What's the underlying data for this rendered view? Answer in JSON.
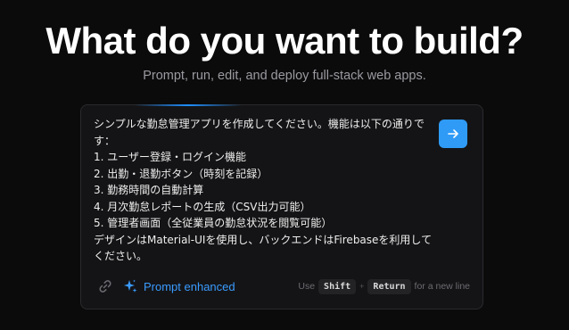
{
  "hero": {
    "title": "What do you want to build?",
    "subtitle": "Prompt, run, edit, and deploy full-stack web apps."
  },
  "prompt": {
    "text": "シンプルな勤怠管理アプリを作成してください。機能は以下の通りです：\n1. ユーザー登録・ログイン機能\n2. 出勤・退勤ボタン（時刻を記録）\n3. 勤務時間の自動計算\n4. 月次勤怠レポートの生成（CSV出力可能）\n5. 管理者画面（全従業員の勤怠状況を閲覧可能）\nデザインはMaterial-UIを使用し、バックエンドはFirebaseを利用してください。"
  },
  "submit": {
    "icon": "arrow-right-icon"
  },
  "footer": {
    "link_icon": "link-icon",
    "enhance_icon": "sparkle-icon",
    "enhance_label": "Prompt enhanced",
    "hint_prefix": "Use",
    "hint_key1": "Shift",
    "hint_plus": "+",
    "hint_key2": "Return",
    "hint_suffix": "for a new line"
  },
  "colors": {
    "background": "#0b0b0c",
    "card": "#141416",
    "accent": "#2f9bf7",
    "enhance_text": "#3a9bff"
  }
}
